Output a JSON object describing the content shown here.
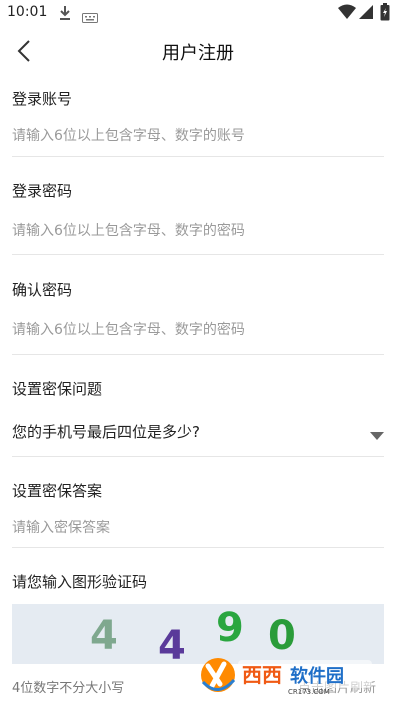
{
  "status_bar": {
    "time": "10:01"
  },
  "header": {
    "title": "用户注册"
  },
  "form": {
    "account": {
      "label": "登录账号",
      "placeholder": "请输入6位以上包含字母、数字的账号"
    },
    "password": {
      "label": "登录密码",
      "placeholder": "请输入6位以上包含字母、数字的密码"
    },
    "confirm_password": {
      "label": "确认密码",
      "placeholder": "请输入6位以上包含字母、数字的密码"
    },
    "security_question": {
      "label": "设置密保问题",
      "selected": "您的手机号最后四位是多少?"
    },
    "security_answer": {
      "label": "设置密保答案",
      "placeholder": "请输入密保答案"
    },
    "captcha": {
      "label": "请您输入图形验证码",
      "digits": [
        "4",
        "4",
        "9",
        "0"
      ],
      "digit_colors": [
        "#7fa88f",
        "#5a3a9a",
        "#2aa640",
        "#2a9c3a"
      ],
      "hint": "4位数字不分大小写",
      "refresh": "点击图片刷新"
    }
  },
  "watermark": {
    "text": "西西软件园",
    "subtext": "CR173.COM"
  },
  "theme": {
    "accent": "#3b8de0",
    "divider": "#e6e6e6",
    "captcha_bg": "#e5ebf2"
  }
}
